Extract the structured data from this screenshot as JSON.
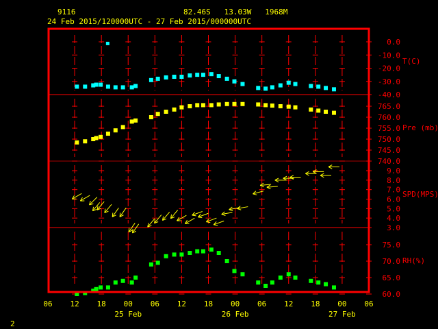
{
  "header": {
    "station": "9116",
    "location": "82.46S   13.03W   1968M",
    "period": "24 Feb 2015/120000UTC - 27 Feb 2015/000000UTC"
  },
  "footer": {
    "page_number": "2"
  },
  "colors": {
    "frame": "#ff0000",
    "text": "#ffff00",
    "temperature": "#00ffff",
    "pressure": "#ffff00",
    "wind": "#ffff00",
    "humidity": "#00ff00",
    "background": "#000000"
  },
  "chart_data": {
    "type": "scatter",
    "x_axis": {
      "range": [
        "2015-02-24T06:00Z",
        "2015-02-27T06:00Z"
      ],
      "tick_labels": [
        "06",
        "12",
        "18",
        "00",
        "06",
        "12",
        "18",
        "00",
        "06",
        "12",
        "18",
        "00",
        "06"
      ],
      "date_labels": [
        "25 Feb",
        "26 Feb",
        "27 Feb"
      ]
    },
    "times": [
      "2015-02-24T12:30Z",
      "2015-02-24T14:20Z",
      "2015-02-24T16:10Z",
      "2015-02-24T16:50Z",
      "2015-02-24T17:50Z",
      "2015-02-24T19:30Z",
      "2015-02-24T21:10Z",
      "2015-02-24T22:50Z",
      "2015-02-25T00:50Z",
      "2015-02-25T01:40Z",
      "2015-02-25T05:10Z",
      "2015-02-25T06:40Z",
      "2015-02-25T08:30Z",
      "2015-02-25T10:20Z",
      "2015-02-25T12:00Z",
      "2015-02-25T13:50Z",
      "2015-02-25T15:30Z",
      "2015-02-25T16:50Z",
      "2015-02-25T18:40Z",
      "2015-02-25T20:20Z",
      "2015-02-25T22:10Z",
      "2015-02-25T23:50Z",
      "2015-02-26T01:40Z",
      "2015-02-26T05:10Z",
      "2015-02-26T06:50Z",
      "2015-02-26T08:20Z",
      "2015-02-26T10:10Z",
      "2015-02-26T12:00Z",
      "2015-02-26T13:30Z",
      "2015-02-26T17:00Z",
      "2015-02-26T18:40Z",
      "2015-02-26T20:20Z",
      "2015-02-26T22:10Z"
    ],
    "panels": [
      {
        "key": "temperature",
        "label": "T(C)",
        "range": [
          -40,
          0
        ],
        "tick_labels": [
          "0.0",
          "-10.0",
          "-20.0",
          "-30.0",
          "-40.0"
        ],
        "tick_values": [
          0,
          -10,
          -20,
          -30,
          -40
        ],
        "values": [
          -34,
          -34,
          -33,
          -32.5,
          -32.5,
          -34,
          -34.5,
          -34.5,
          -34.5,
          -33.5,
          -29,
          -28,
          -27,
          -26.5,
          -26.5,
          -25.5,
          -25,
          -25,
          -24.5,
          -26,
          -28,
          -30,
          -32,
          -35,
          -35.5,
          -34.5,
          -33,
          -31,
          -32,
          -33.5,
          -34,
          -35,
          -36
        ],
        "outliers": [
          {
            "time": "2015-02-24T19:20Z",
            "value": -1
          }
        ]
      },
      {
        "key": "pressure",
        "label": "Pre (mb)",
        "range": [
          740,
          768
        ],
        "tick_labels": [
          "765.0",
          "760.0",
          "755.0",
          "750.0",
          "745.0",
          "740.0"
        ],
        "tick_values": [
          765,
          760,
          755,
          750,
          745,
          740
        ],
        "values": [
          748.5,
          749,
          750,
          750.5,
          751,
          752.5,
          754,
          755.5,
          758,
          758.5,
          760,
          761.5,
          762.5,
          763.5,
          764.5,
          765,
          765.5,
          765.5,
          765.5,
          765.8,
          766,
          766,
          766,
          765.8,
          765.5,
          765.3,
          765,
          764.8,
          764.5,
          763.5,
          763,
          762.5,
          762
        ]
      },
      {
        "key": "wind",
        "label": "SPD(MPS)",
        "range": [
          3,
          9.8
        ],
        "tick_labels": [
          "9.0",
          "8.0",
          "7.0",
          "6.0",
          "5.0",
          "4.0",
          "3.0"
        ],
        "tick_values": [
          9,
          8,
          7,
          6,
          5,
          4,
          3
        ],
        "values": [
          6.3,
          6.1,
          5.8,
          5.2,
          5.3,
          5.0,
          4.6,
          4.6,
          3.0,
          2.9,
          3.5,
          3.9,
          4.2,
          4.4,
          4.0,
          3.7,
          4.5,
          4.3,
          3.8,
          3.5,
          4.5,
          5.0,
          5.1,
          6.7,
          7.5,
          7.3,
          8.0,
          8.2,
          8.3,
          8.7,
          8.9,
          8.5,
          9.4
        ],
        "direction_from_deg": [
          60,
          60,
          45,
          40,
          40,
          40,
          35,
          35,
          35,
          35,
          40,
          40,
          40,
          40,
          60,
          60,
          70,
          70,
          70,
          70,
          80,
          80,
          80,
          75,
          85,
          85,
          90,
          90,
          90,
          90,
          90,
          90,
          90
        ]
      },
      {
        "key": "humidity",
        "label": "RH(%)",
        "range": [
          60,
          78
        ],
        "tick_labels": [
          "75.0",
          "70.0",
          "65.0",
          "60.0"
        ],
        "tick_values": [
          75,
          70,
          65,
          60
        ],
        "values": [
          60,
          60.3,
          61,
          61.5,
          62,
          62,
          63.5,
          64,
          63.5,
          65,
          69,
          69.5,
          71.5,
          72,
          72,
          72.5,
          73,
          73,
          73.5,
          72.5,
          70,
          67,
          66,
          63.5,
          62.5,
          63.5,
          65,
          66,
          65,
          64,
          63.5,
          63,
          62
        ]
      }
    ]
  }
}
